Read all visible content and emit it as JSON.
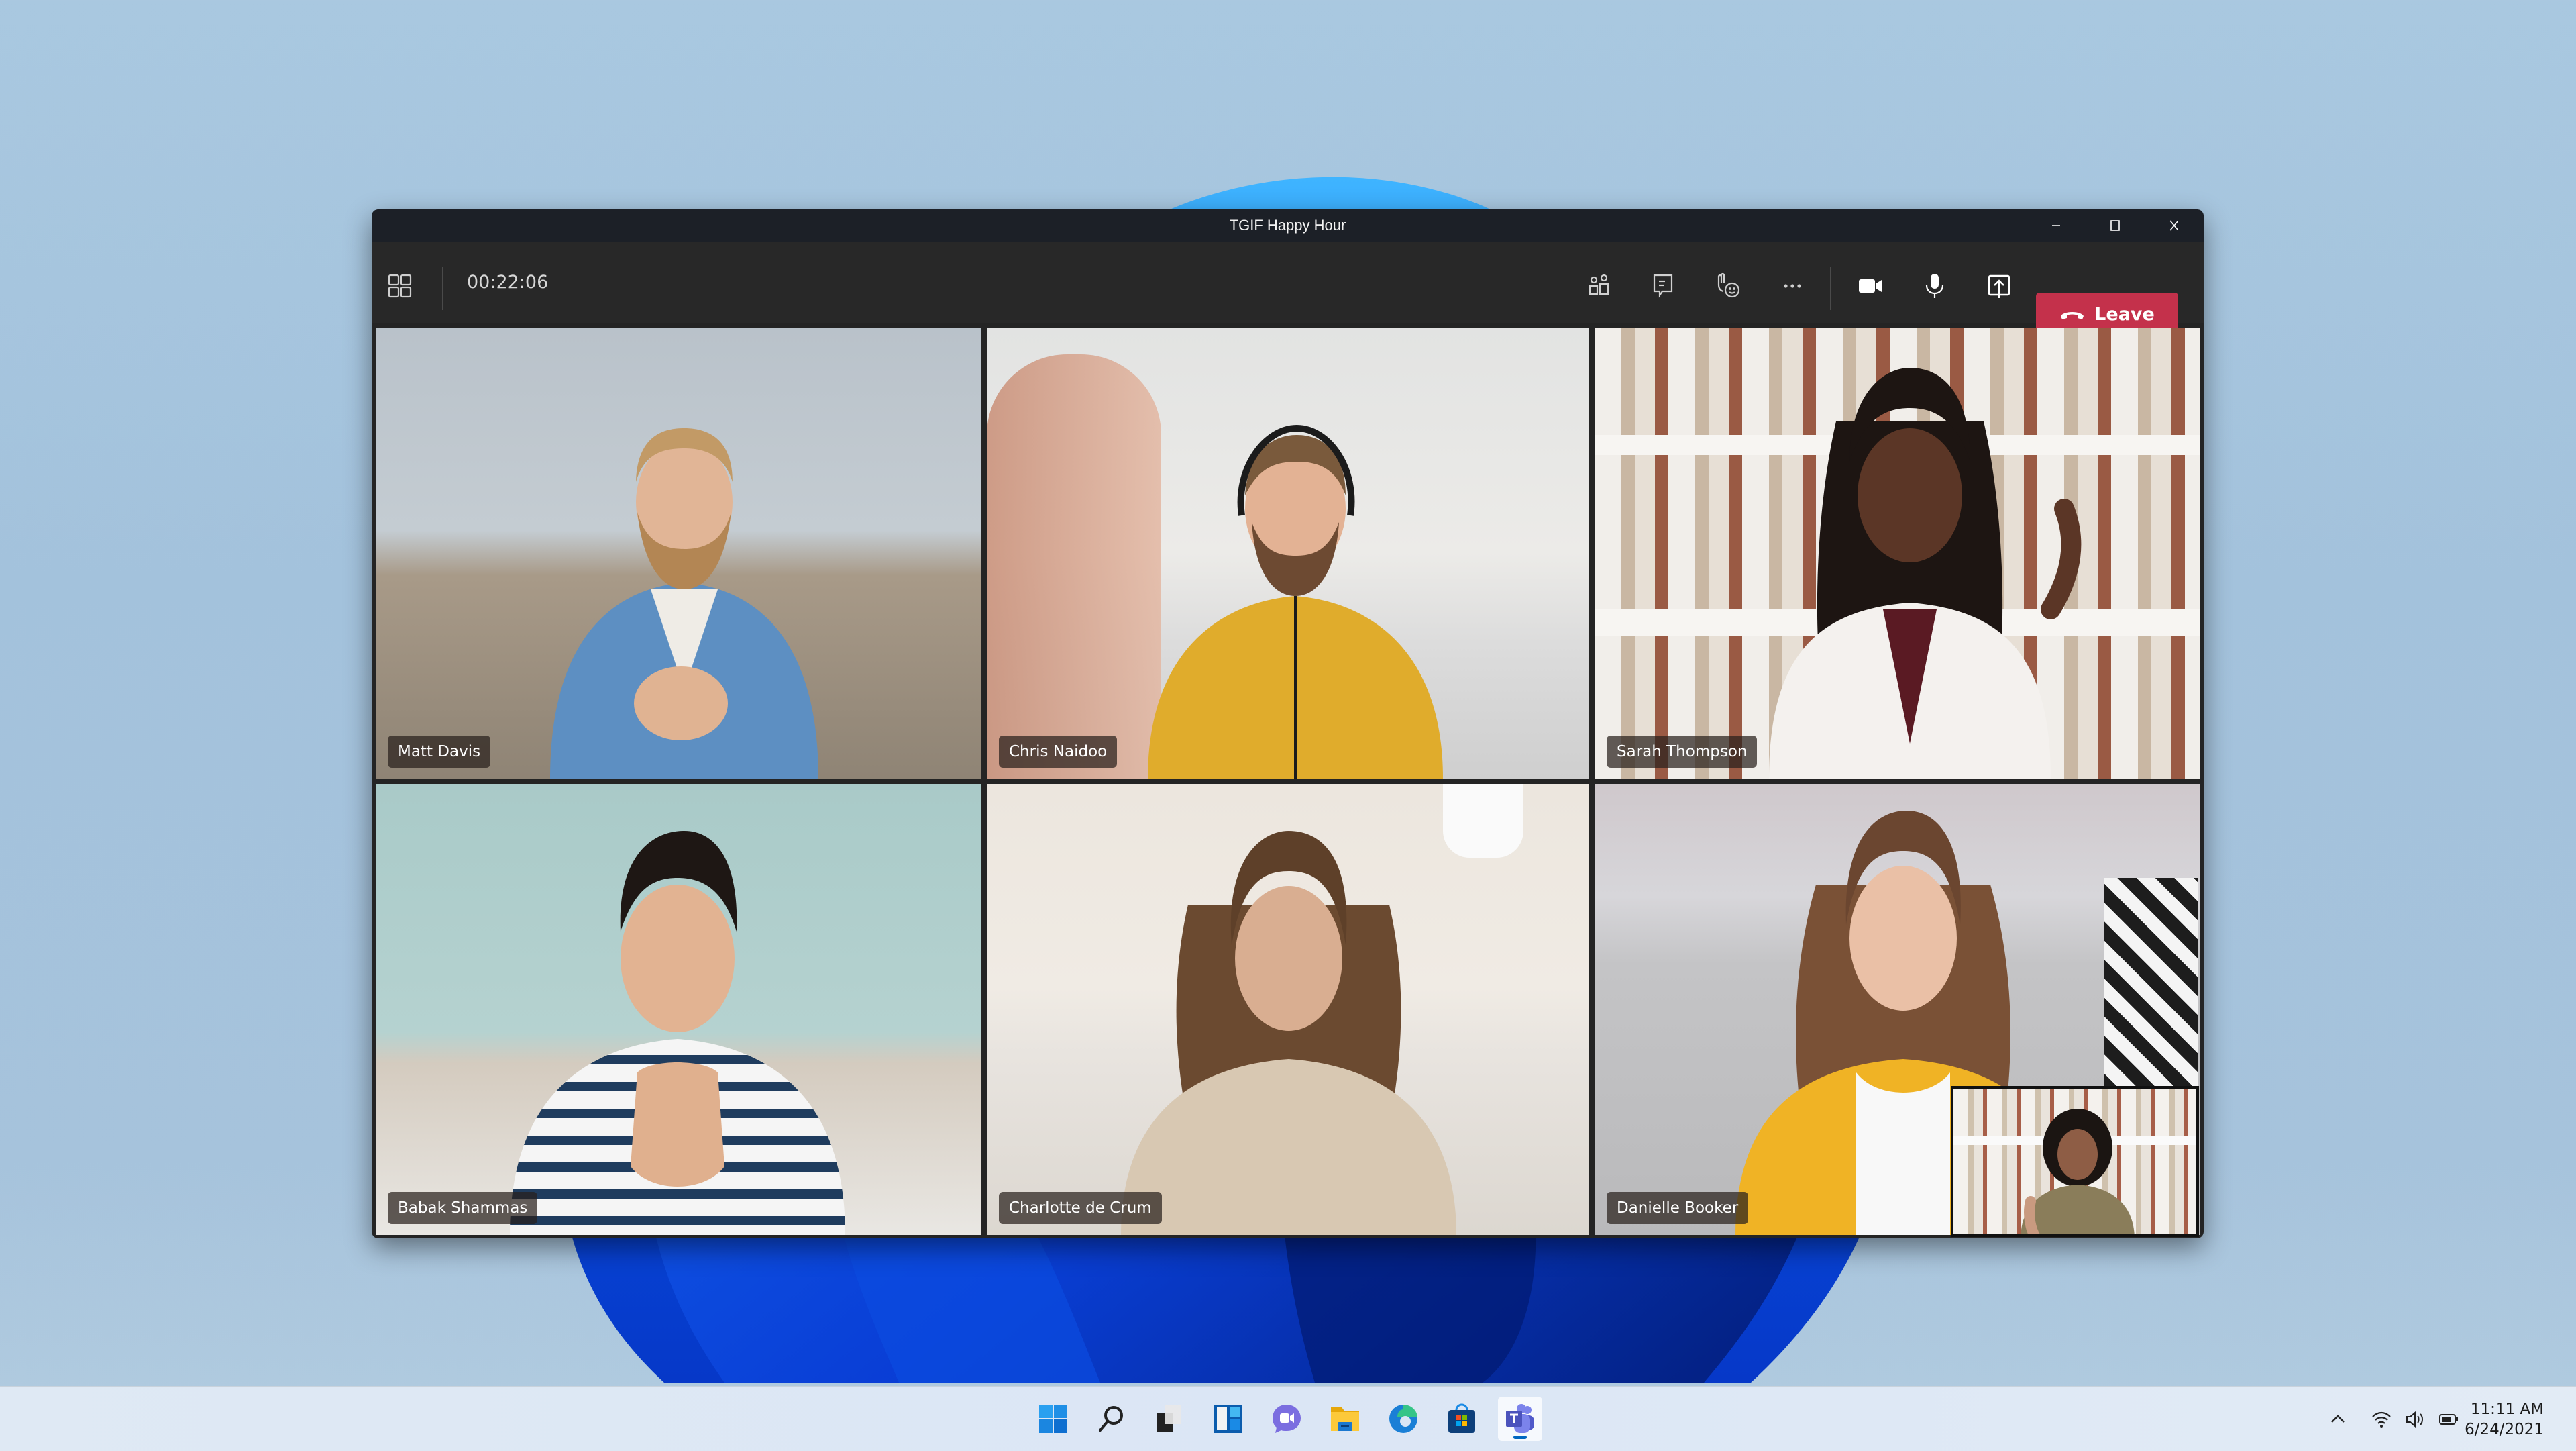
{
  "window": {
    "title": "TGIF Happy Hour",
    "controls": {
      "minimize": "minimize",
      "maximize": "maximize",
      "close": "close"
    }
  },
  "toolbar": {
    "layout_icon": "grid-layout-icon",
    "timer": "00:22:06",
    "buttons": [
      {
        "name": "people",
        "icon": "people-icon"
      },
      {
        "name": "chat",
        "icon": "chat-icon"
      },
      {
        "name": "reactions",
        "icon": "raise-hand-reaction-icon"
      },
      {
        "name": "more",
        "icon": "more-icon"
      },
      {
        "name": "camera",
        "icon": "camera-icon"
      },
      {
        "name": "mic",
        "icon": "mic-icon"
      },
      {
        "name": "share",
        "icon": "share-screen-icon"
      }
    ],
    "leave_label": "Leave",
    "leave_color": "#c4314b"
  },
  "participants": [
    {
      "name": "Matt Davis"
    },
    {
      "name": "Chris Naidoo"
    },
    {
      "name": "Sarah Thompson"
    },
    {
      "name": "Babak Shammas"
    },
    {
      "name": "Charlotte de Crum"
    },
    {
      "name": "Danielle Booker"
    }
  ],
  "self_view": {
    "label": "self-view"
  },
  "taskbar": {
    "apps": [
      {
        "name": "start",
        "icon": "windows-start-icon"
      },
      {
        "name": "search",
        "icon": "search-icon"
      },
      {
        "name": "task-view",
        "icon": "task-view-icon"
      },
      {
        "name": "widgets",
        "icon": "widgets-icon"
      },
      {
        "name": "chat",
        "icon": "teams-chat-icon"
      },
      {
        "name": "file-explorer",
        "icon": "folder-icon"
      },
      {
        "name": "edge",
        "icon": "edge-icon"
      },
      {
        "name": "store",
        "icon": "store-icon"
      },
      {
        "name": "teams",
        "icon": "teams-icon",
        "active": true
      }
    ],
    "tray": [
      "chevron-up-icon",
      "wifi-icon",
      "volume-icon",
      "battery-icon"
    ],
    "time": "11:11 AM",
    "date": "6/24/2021"
  }
}
